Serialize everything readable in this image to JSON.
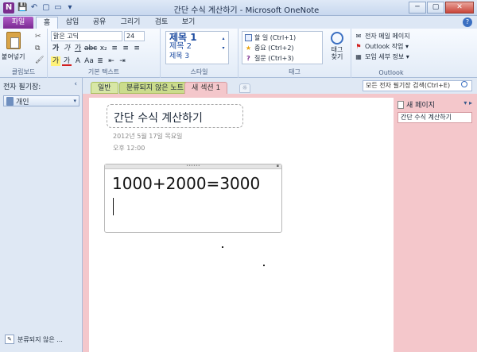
{
  "window": {
    "title": "간단 수식 계산하기 - Microsoft OneNote",
    "app_icon": "N",
    "qat": [
      "save-icon",
      "undo-icon",
      "view-icon",
      "dock-icon",
      "customize-icon"
    ],
    "qat_glyphs": [
      "💾",
      "↶",
      "▢",
      "▭",
      "▾"
    ],
    "controls": {
      "minimize": "─",
      "maximize": "▢",
      "close": "✕"
    }
  },
  "ribbon_tabs": [
    {
      "label": "파일"
    },
    {
      "label": "홈"
    },
    {
      "label": "삽입"
    },
    {
      "label": "공유"
    },
    {
      "label": "그리기"
    },
    {
      "label": "검토"
    },
    {
      "label": "보기"
    }
  ],
  "help": "?",
  "clipboard": {
    "paste_label": "붙여넣기",
    "side_glyphs": [
      "✂",
      "⧉",
      "🖌"
    ],
    "group_label": "클립보드"
  },
  "basic_text": {
    "font": "맑은 고딕",
    "size": "24",
    "row2": [
      "가",
      "가",
      "가",
      "abc",
      "x₂",
      "≡",
      "≡",
      "≡"
    ],
    "row3": [
      "가",
      "가",
      "A",
      "Aa",
      "≣",
      "⇤",
      "⇥"
    ],
    "group_label": "기본 텍스트"
  },
  "styles": {
    "items": [
      "제목 1",
      "제목 2",
      "제목 3"
    ],
    "group_label": "스타일"
  },
  "tags": {
    "items": [
      {
        "label": "할 일 (Ctrl+1)",
        "icon": "checkbox-icon"
      },
      {
        "label": "중요 (Ctrl+2)",
        "icon": "star-icon"
      },
      {
        "label": "질문 (Ctrl+3)",
        "icon": "question-icon"
      }
    ],
    "find_label": "태그 찾기",
    "group_label": "태그"
  },
  "outlook": {
    "items": [
      {
        "label": "전자 메일 페이지",
        "icon": "email-icon"
      },
      {
        "label": "Outlook 작업 ▾",
        "icon": "flag-icon"
      },
      {
        "label": "모임 세부 정보 ▾",
        "icon": "meeting-icon"
      }
    ],
    "group_label": "Outlook"
  },
  "navpane": {
    "header": "전자 필기장:",
    "collapse": "‹",
    "notebook": "개인",
    "unfiled": "분류되지 않은 ..."
  },
  "sections": {
    "tabs": [
      "일반",
      "분류되지 않은 노트",
      "새 섹션 1"
    ],
    "add": "☼",
    "search_placeholder": "모든 전자 필기장 검색(Ctrl+E)"
  },
  "page": {
    "title": "간단 수식 계산하기",
    "date": "2012년 5월 17일 목요일",
    "time": "오후 12:00",
    "note_text": "1000+2000=3000"
  },
  "pages_pane": {
    "new_page": "새 페이지",
    "arrows": "▾ ▸",
    "entries": [
      "간단 수식 계산하기"
    ]
  }
}
